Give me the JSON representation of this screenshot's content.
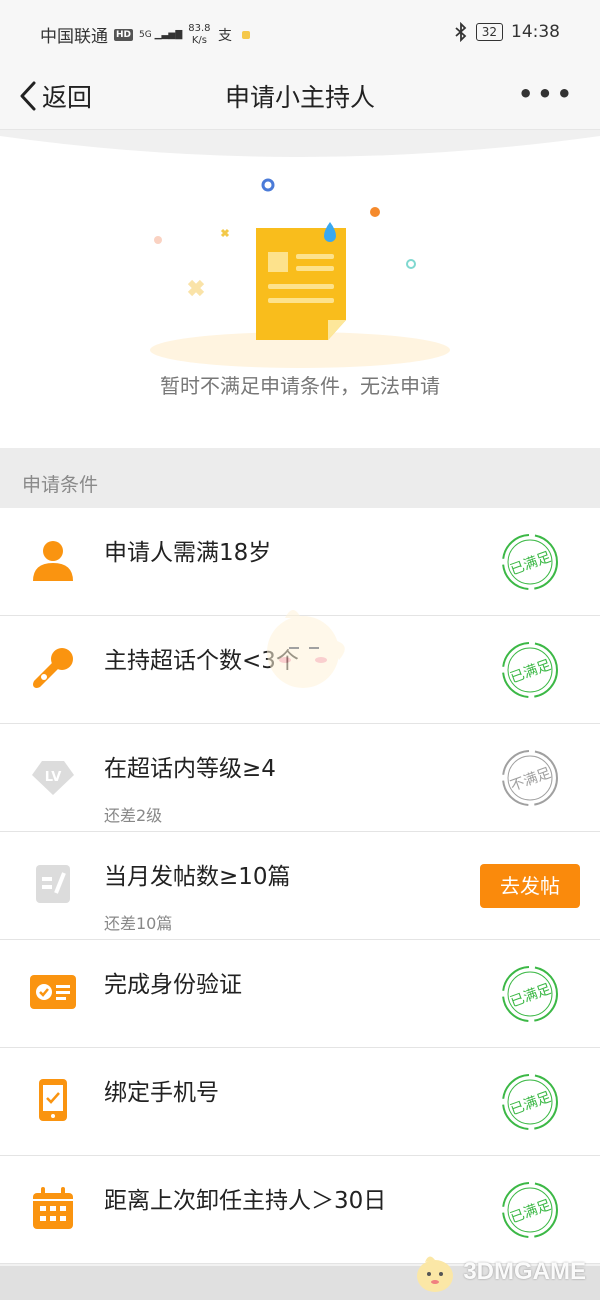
{
  "status_bar": {
    "carrier": "中国联通",
    "hd": "HD",
    "signal": "5G",
    "net_speed_value": "83.8",
    "net_speed_unit": "K/s",
    "battery": "32",
    "time": "14:38"
  },
  "nav": {
    "back_label": "返回",
    "title": "申请小主持人",
    "more": "•••"
  },
  "hero": {
    "message": "暂时不满足申请条件，无法申请"
  },
  "section": {
    "title": "申请条件"
  },
  "conditions": [
    {
      "icon": "user-icon",
      "title": "申请人需满18岁",
      "sub": "",
      "status": "已满足"
    },
    {
      "icon": "microphone-icon",
      "title": "主持超话个数<3个",
      "sub": "",
      "status": "已满足"
    },
    {
      "icon": "level-diamond-icon",
      "title": "在超话内等级≥4",
      "sub": "还差2级",
      "status": "不满足"
    },
    {
      "icon": "post-icon",
      "title": "当月发帖数≥10篇",
      "sub": "还差10篇",
      "action": "去发帖"
    },
    {
      "icon": "id-card-icon",
      "title": "完成身份验证",
      "sub": "",
      "status": "已满足"
    },
    {
      "icon": "phone-icon",
      "title": "绑定手机号",
      "sub": "",
      "status": "已满足"
    },
    {
      "icon": "calendar-icon",
      "title": "距离上次卸任主持人＞30日",
      "sub": "",
      "status": "已满足"
    }
  ],
  "lv_text": "LV",
  "watermark": "3DMGAME",
  "colors": {
    "accent_orange": "#fa8a0c",
    "met_green": "#3cb846",
    "unmet_gray": "#a0a0a0"
  }
}
